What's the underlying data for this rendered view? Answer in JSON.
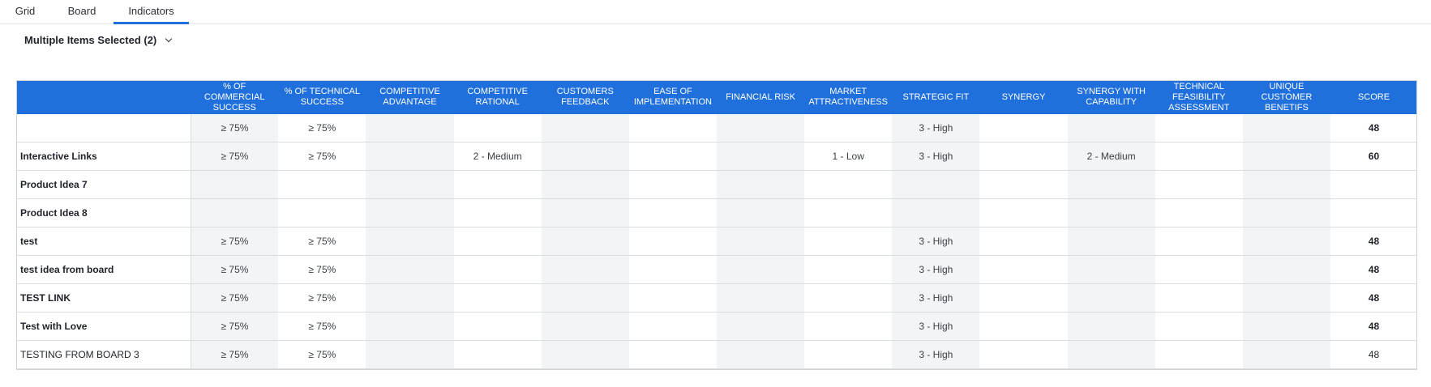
{
  "tabs": {
    "grid": "Grid",
    "board": "Board",
    "indicators": "Indicators"
  },
  "selector_label": "Multiple Items Selected (2)",
  "columns": [
    "",
    "% of Commercial Success",
    "% of Technical Success",
    "Competitive Advantage",
    "Competitive Rational",
    "Customers Feedback",
    "Ease of Implementation",
    "Financial Risk",
    "Market Attractiveness",
    "Strategic Fit",
    "Synergy",
    "Synergy with Capability",
    "Technical Feasibility Assessment",
    "Unique Customer Benetifs",
    "Score"
  ],
  "rows": [
    {
      "name": "",
      "values": [
        "≥ 75%",
        "≥ 75%",
        "",
        "",
        "",
        "",
        "",
        "",
        "3 - High",
        "",
        "",
        "",
        "",
        "48"
      ],
      "bold": true
    },
    {
      "name": "Interactive Links",
      "values": [
        "≥ 75%",
        "≥ 75%",
        "",
        "2 - Medium",
        "",
        "",
        "",
        "1 - Low",
        "3 - High",
        "",
        "2 - Medium",
        "",
        "",
        "60"
      ],
      "bold": true
    },
    {
      "name": "Product Idea 7",
      "values": [
        "",
        "",
        "",
        "",
        "",
        "",
        "",
        "",
        "",
        "",
        "",
        "",
        "",
        ""
      ],
      "bold": true
    },
    {
      "name": "Product Idea 8",
      "values": [
        "",
        "",
        "",
        "",
        "",
        "",
        "",
        "",
        "",
        "",
        "",
        "",
        "",
        ""
      ],
      "bold": true
    },
    {
      "name": "test",
      "values": [
        "≥ 75%",
        "≥ 75%",
        "",
        "",
        "",
        "",
        "",
        "",
        "3 - High",
        "",
        "",
        "",
        "",
        "48"
      ],
      "bold": true
    },
    {
      "name": "test idea from board",
      "values": [
        "≥ 75%",
        "≥ 75%",
        "",
        "",
        "",
        "",
        "",
        "",
        "3 - High",
        "",
        "",
        "",
        "",
        "48"
      ],
      "bold": true
    },
    {
      "name": "TEST LINK",
      "values": [
        "≥ 75%",
        "≥ 75%",
        "",
        "",
        "",
        "",
        "",
        "",
        "3 - High",
        "",
        "",
        "",
        "",
        "48"
      ],
      "bold": true
    },
    {
      "name": "Test with Love",
      "values": [
        "≥ 75%",
        "≥ 75%",
        "",
        "",
        "",
        "",
        "",
        "",
        "3 - High",
        "",
        "",
        "",
        "",
        "48"
      ],
      "bold": true
    },
    {
      "name": "TESTING FROM BOARD 3",
      "values": [
        "≥ 75%",
        "≥ 75%",
        "",
        "",
        "",
        "",
        "",
        "",
        "3 - High",
        "",
        "",
        "",
        "",
        "48"
      ],
      "bold": false
    }
  ],
  "colors": {
    "header_bg": "#1f6fdc",
    "alt_col_bg": "#f3f4f6"
  }
}
